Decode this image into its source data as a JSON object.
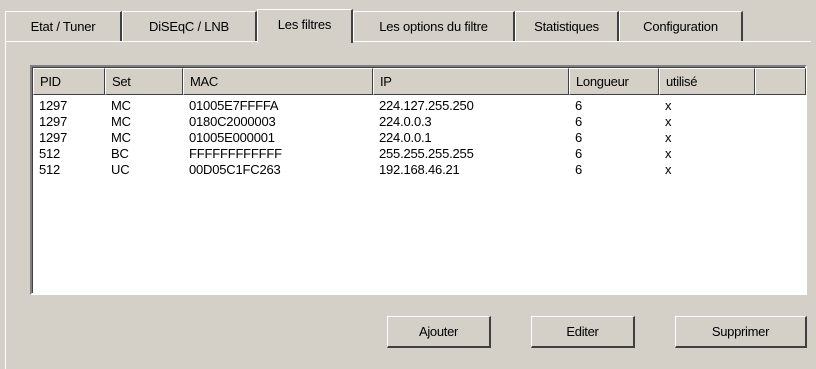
{
  "tabs": [
    {
      "label": "Etat / Tuner",
      "active": false
    },
    {
      "label": "DiSEqC / LNB",
      "active": false
    },
    {
      "label": "Les filtres",
      "active": true
    },
    {
      "label": "Les options du filtre",
      "active": false
    },
    {
      "label": "Statistiques",
      "active": false
    },
    {
      "label": "Configuration",
      "active": false
    }
  ],
  "filter_table": {
    "columns": [
      "PID",
      "Set",
      "MAC",
      "IP",
      "Longueur",
      "utilisé",
      ""
    ],
    "rows": [
      [
        "1297",
        "MC",
        "01005E7FFFFA",
        "224.127.255.250",
        "6",
        "x"
      ],
      [
        "1297",
        "MC",
        "0180C2000003",
        "224.0.0.3",
        "6",
        "x"
      ],
      [
        "1297",
        "MC",
        "01005E000001",
        "224.0.0.1",
        "6",
        "x"
      ],
      [
        "512",
        "BC",
        "FFFFFFFFFFFF",
        "255.255.255.255",
        "6",
        "x"
      ],
      [
        "512",
        "UC",
        "00D05C1FC263",
        "192.168.46.21",
        "6",
        "x"
      ]
    ]
  },
  "buttons": {
    "add": "Ajouter",
    "edit": "Editer",
    "delete": "Supprimer"
  }
}
